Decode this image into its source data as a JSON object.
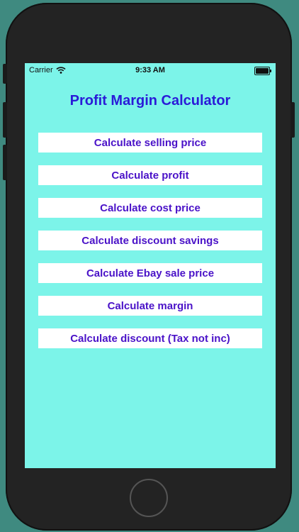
{
  "status_bar": {
    "carrier": "Carrier",
    "time": "9:33 AM",
    "wifi_icon": "wifi-icon",
    "battery_icon": "battery-icon"
  },
  "title": "Profit Margin Calculator",
  "menu": [
    {
      "label": "Calculate selling price"
    },
    {
      "label": "Calculate profit"
    },
    {
      "label": "Calculate cost price"
    },
    {
      "label": "Calculate discount savings"
    },
    {
      "label": "Calculate Ebay sale price"
    },
    {
      "label": "Calculate margin"
    },
    {
      "label": "Calculate discount (Tax not inc)"
    }
  ],
  "colors": {
    "screen_background": "#7cf4e9",
    "title_text": "#2a1bd8",
    "button_text": "#4a12c8",
    "button_background": "#ffffff"
  }
}
